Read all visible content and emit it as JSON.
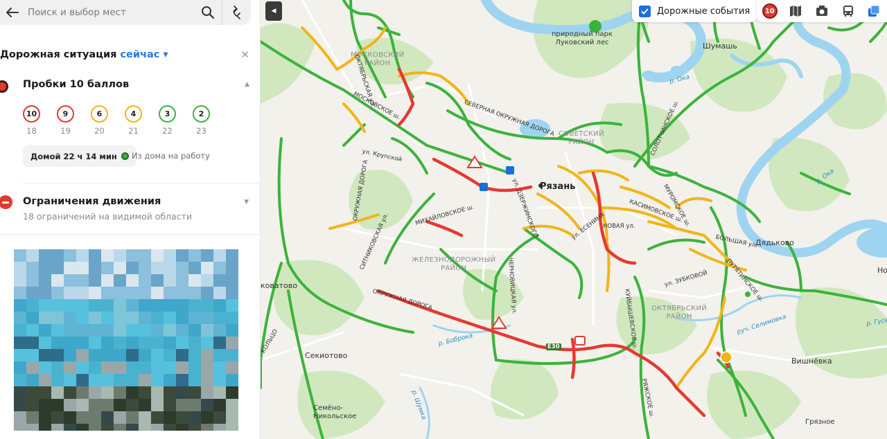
{
  "search": {
    "placeholder": "Поиск и выбор мест"
  },
  "traffic": {
    "title": "Дорожная ситуация",
    "when": "сейчас ▾",
    "jam_title": "Пробки 10 баллов",
    "jam_level": 10,
    "forecast": [
      {
        "score": "10",
        "hour": "18",
        "color": "#e33a30"
      },
      {
        "score": "9",
        "hour": "19",
        "color": "#e33a30"
      },
      {
        "score": "6",
        "hour": "20",
        "color": "#f2b418"
      },
      {
        "score": "4",
        "hour": "21",
        "color": "#f2b418"
      },
      {
        "score": "3",
        "hour": "22",
        "color": "#3bb33b"
      },
      {
        "score": "2",
        "hour": "23",
        "color": "#3bb33b"
      }
    ],
    "home_chip": "Домой 22 ч 14 мин",
    "work_link": "Из дома на работу"
  },
  "restrictions": {
    "title": "Ограничения движения",
    "subtitle": "18 ограничений на видимой области"
  },
  "map_controls": {
    "events_label": "Дорожные события",
    "traffic_badge": "10"
  },
  "map_labels": {
    "city": "Рязань",
    "park": "природный парк\nЛуковский лес",
    "districts": {
      "moskovsky": "МОСКОВСКИЙ\nРАЙОН",
      "sovetsky": "СОВЕТСКИЙ\nРАЙОН",
      "zheleznodorozhny": "ЖЕЛЕЗНОДОРОЖНЫЙ\nРАЙОН",
      "oktyabrsky": "ОКТЯБРЬСКИЙ\nРАЙОН"
    },
    "towns": {
      "shumash": "Шумашь",
      "dyadkovo": "Дядьково",
      "vishnyovka": "Вишнёвка",
      "sekiotovo": "Секиотово",
      "semeno": "Семёно-\nНикольское",
      "koratovo": "коватово",
      "gryatskoe": "Грязное",
      "no": "Но"
    },
    "streets": {
      "moskovskoe": "МОСКОВСКОЕ ш.",
      "severnaya": "СЕВЕРНАЯ ОКРУЖНАЯ ДОРОГА",
      "okruzhnaya_west": "ОКРУЖНАЯ ДОРОГА",
      "okruzhnaya_south": "ОКРУЖНАЯ ДОРОГА",
      "oktyabrskaya": "ОКТЯБРЬСКАЯ ул.",
      "krupskoy": "ул. Крупской",
      "mikhaylovskoe": "МИХАЙЛОВСКОЕ ш.",
      "sitnikovskaya": "СИТНИКОВСКАЯ ул.",
      "dzerzhinskogo": "ул. ДЗЕРЖИНСКОГО",
      "chernovitskaya": "ЧЕРНОВИЦКАЯ ул.",
      "yesenina": "ул. ЕСЕНИНА",
      "kasimovskoe": "КАСИМОВСКОЕ ш.",
      "muromskoe": "МУРОМСКОЕ ш.",
      "solotchinskoe": "СОЛОТЧИНСКОЕ ш.",
      "kuybyshevskoe": "КУЙБЫШЕВСКОЕ ш.",
      "ryazhskoe": "РЯЖСКОЕ ш.",
      "zubkovoy": "ул. ЗУБКОВОЙ",
      "novaya": "НОВАЯ ул.",
      "bolshaya": "БОЛЬШАЯ ул.",
      "putyatino": "ПУТЯТИНСКОЕ ш.",
      "e30": "E30",
      "koltso": "КОЛЬЦО"
    },
    "rivers": {
      "oka1": "р. Ока",
      "oka2": "р. Ока",
      "borovka": "р. Боброка",
      "selimovka": "руч. Селимовка",
      "shumka": "р. Шумка",
      "gusevka": "р. Гусев"
    }
  },
  "colors": {
    "jam_red": "#e33a30",
    "moderate_yellow": "#f2b418",
    "free_green": "#3bb33b",
    "accent_blue": "#2a7be0",
    "water": "#9fd4f0",
    "park": "#c8e6b5"
  }
}
